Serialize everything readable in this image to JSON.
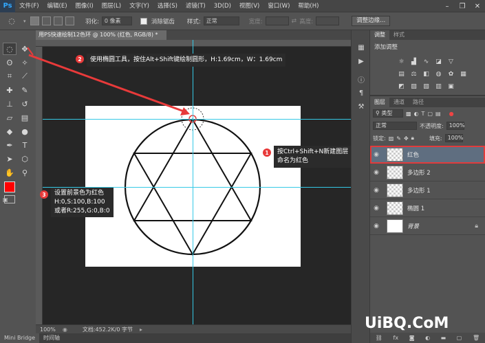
{
  "app": {
    "logo": "Ps",
    "menu": [
      "文件(F)",
      "编辑(E)",
      "图像(I)",
      "图层(L)",
      "文字(Y)",
      "选择(S)",
      "滤镜(T)",
      "3D(D)",
      "视图(V)",
      "窗口(W)",
      "帮助(H)"
    ]
  },
  "options_bar": {
    "feather_label": "羽化:",
    "feather_value": "0 像素",
    "antialias_label": "消除锯齿",
    "style_label": "样式:",
    "style_value": "正常",
    "width_label": "宽度:",
    "height_label": "高度:",
    "refine_edge_button": "调整边缘..."
  },
  "document": {
    "tab_title": "用PS快速绘制12色环 @ 100% (红色, RGB/8) *",
    "zoom": "100%",
    "doc_info": "文档:452.2K/0 字节"
  },
  "bottom_tabs": [
    "Mini Bridge",
    "时间轴"
  ],
  "annotations": {
    "step1_num": "1",
    "step1_text_line1": "按Ctrl+Shift+N新建图层",
    "step1_text_line2": "命名为红色",
    "step2_num": "2",
    "step2_text": "使用椭圆工具，按住Alt+Shift键绘制圆形，H:1.69cm，W：1.69cm",
    "step3_num": "3",
    "step3_line1": "设置前景色为红色",
    "step3_line2": "H:0,S:100,B:100",
    "step3_line3": "或者R:255,G:0,B:0"
  },
  "colors": {
    "foreground": "#ff0000",
    "background": "#ffffff",
    "guide": "#35c9e6",
    "highlight": "#e23b3b"
  },
  "adjustments_panel": {
    "tabs": [
      "调整",
      "样式"
    ],
    "title": "添加调整"
  },
  "layers_panel": {
    "tabs": [
      "图层",
      "通道",
      "路径"
    ],
    "filter_label": "类型",
    "blend_mode": "正常",
    "opacity_label": "不透明度:",
    "opacity_value": "100%",
    "lock_label": "锁定:",
    "fill_label": "填充:",
    "fill_value": "100%",
    "layers": [
      {
        "name": "红色",
        "selected": true
      },
      {
        "name": "多边形 2",
        "selected": false
      },
      {
        "name": "多边形 1",
        "selected": false
      },
      {
        "name": "椭圆 1",
        "selected": false
      },
      {
        "name": "背景",
        "selected": false
      }
    ]
  },
  "watermark": "UiBQ.CoM"
}
